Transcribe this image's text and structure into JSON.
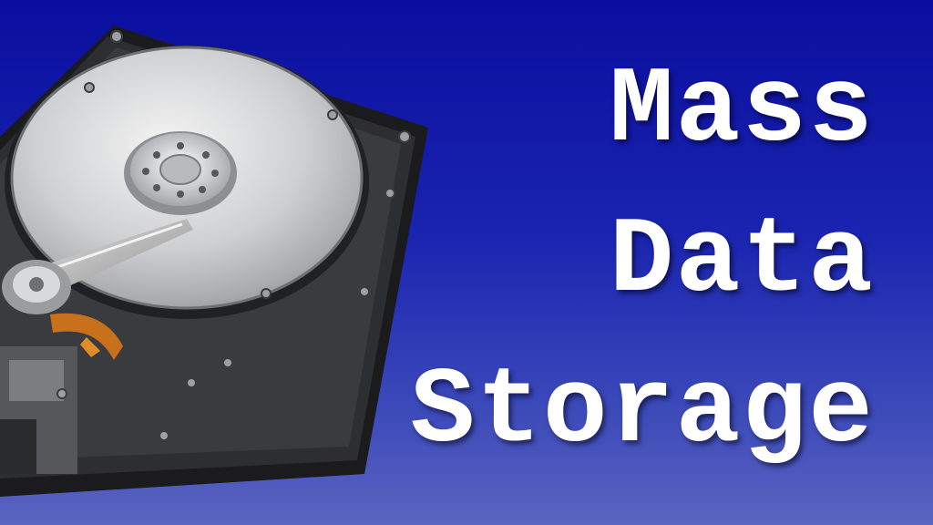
{
  "title": {
    "line1": "Mass",
    "line2": "Data",
    "line3": "Storage"
  },
  "image": {
    "subject": "hard-disk-drive-icon"
  },
  "colors": {
    "background_top": "#0a0e9e",
    "background_bottom": "#5a64c0",
    "text": "#ffffff"
  }
}
